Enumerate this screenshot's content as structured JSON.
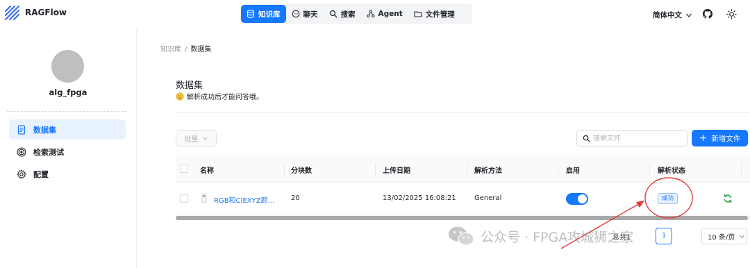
{
  "app": {
    "name": "RAGFlow"
  },
  "nav": {
    "items": [
      {
        "label": "知识库",
        "icon": "database-icon",
        "active": true
      },
      {
        "label": "聊天",
        "icon": "chat-bubble-icon",
        "active": false
      },
      {
        "label": "搜索",
        "icon": "search-icon",
        "active": false
      },
      {
        "label": "Agent",
        "icon": "agent-graph-icon",
        "active": false
      },
      {
        "label": "文件管理",
        "icon": "folder-icon",
        "active": false
      }
    ]
  },
  "header": {
    "language": "简体中文"
  },
  "sidebar": {
    "kb_name": "alg_fpga",
    "items": [
      {
        "label": "数据集",
        "icon": "document-icon",
        "active": true
      },
      {
        "label": "检索测试",
        "icon": "target-icon",
        "active": false
      },
      {
        "label": "配置",
        "icon": "gear-icon",
        "active": false
      }
    ]
  },
  "breadcrumb": {
    "parent": "知识库",
    "separator": "/",
    "current": "数据集"
  },
  "page": {
    "title": "数据集",
    "subtitle": "解析成功后才能问答哦。"
  },
  "toolbar": {
    "batch_label": "批量",
    "search_placeholder": "搜索文件",
    "add_label": "新增文件"
  },
  "table": {
    "columns": [
      "名称",
      "分块数",
      "上传日期",
      "解析方法",
      "启用",
      "解析状态"
    ],
    "rows": [
      {
        "name": "RGB和CIEXYZ颜...",
        "chunks": "20",
        "upload_date": "13/02/2025 16:08:21",
        "parser": "General",
        "enabled": true,
        "status": "成功"
      }
    ]
  },
  "pagination": {
    "total": "总共1",
    "current_page": "1",
    "page_size": "10 条/页"
  },
  "watermark": {
    "text": "公众号 · FPGA攻城狮之家"
  },
  "colors": {
    "accent": "#1677ff",
    "success": "#1a9c3e",
    "annotation": "#e53935"
  }
}
